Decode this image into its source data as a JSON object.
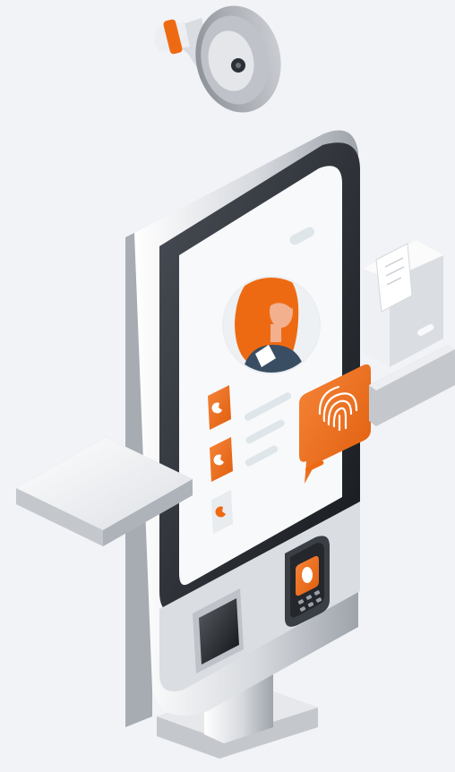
{
  "illustration": {
    "subject": "self-service-kiosk-with-face-and-fingerprint-identification",
    "icons": [
      "megaphone-icon",
      "user-avatar-icon",
      "fingerprint-icon",
      "receipt-printer-icon",
      "card-terminal-icon",
      "menu-item-icon"
    ],
    "colors": {
      "background": "#f1f3f7",
      "accent": "#ee6a12",
      "accent_dark": "#c94f07",
      "frame_light": "#e9ebef",
      "frame_mid": "#c6cad0",
      "frame_dark": "#2b2f36",
      "screen": "#f8f9fb",
      "placeholder": "#dfe6ea",
      "shirt": "#3a4e63",
      "skin": "#f2b08f"
    }
  }
}
